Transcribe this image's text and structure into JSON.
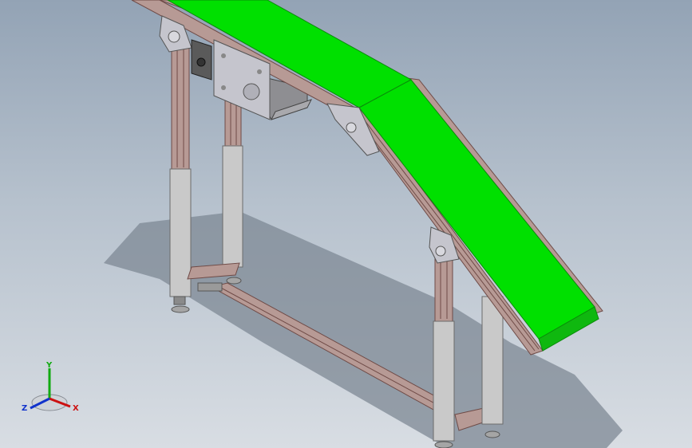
{
  "viewport": {
    "background_top": "#93a3b5",
    "background_bottom": "#d8dde3"
  },
  "model": {
    "belt_color": "#00e000",
    "belt_edge_color": "#0a8a0a",
    "frame_color": "#b79a95",
    "frame_edge_color": "#6f4b47",
    "leg_color": "#c9c9c9",
    "leg_edge_color": "#6b6b6b",
    "plate_color": "#c5c5cd",
    "motor_color": "#8e8e92",
    "control_box_color": "#5a5a5a",
    "shadow_color": "#7e8894"
  },
  "triad": {
    "x_label": "X",
    "y_label": "Y",
    "z_label": "Z",
    "x_color": "#cc1111",
    "y_color": "#11aa11",
    "z_color": "#1133cc"
  }
}
